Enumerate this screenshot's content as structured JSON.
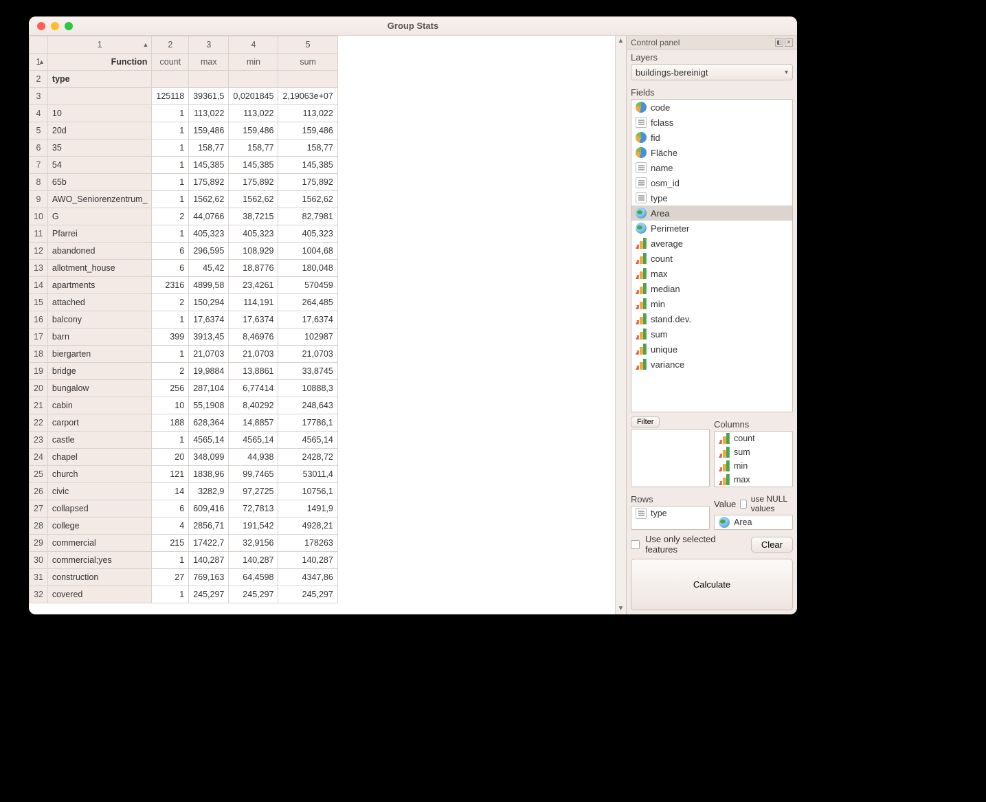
{
  "window_title": "Group Stats",
  "table": {
    "top_headers": [
      "1",
      "2",
      "3",
      "4",
      "5"
    ],
    "function_label": "Function",
    "func_cols": [
      "count",
      "max",
      "min",
      "sum"
    ],
    "type_label": "type",
    "rows": [
      {
        "n": "3",
        "type": "",
        "count": "125118",
        "max": "39361,5",
        "min": "0,0201845",
        "sum": "2,19063e+07"
      },
      {
        "n": "4",
        "type": "10",
        "count": "1",
        "max": "113,022",
        "min": "113,022",
        "sum": "113,022"
      },
      {
        "n": "5",
        "type": "20d",
        "count": "1",
        "max": "159,486",
        "min": "159,486",
        "sum": "159,486"
      },
      {
        "n": "6",
        "type": "35",
        "count": "1",
        "max": "158,77",
        "min": "158,77",
        "sum": "158,77"
      },
      {
        "n": "7",
        "type": "54",
        "count": "1",
        "max": "145,385",
        "min": "145,385",
        "sum": "145,385"
      },
      {
        "n": "8",
        "type": "65b",
        "count": "1",
        "max": "175,892",
        "min": "175,892",
        "sum": "175,892"
      },
      {
        "n": "9",
        "type": "AWO_Seniorenzentrum_",
        "count": "1",
        "max": "1562,62",
        "min": "1562,62",
        "sum": "1562,62"
      },
      {
        "n": "10",
        "type": "G",
        "count": "2",
        "max": "44,0766",
        "min": "38,7215",
        "sum": "82,7981"
      },
      {
        "n": "11",
        "type": "Pfarrei",
        "count": "1",
        "max": "405,323",
        "min": "405,323",
        "sum": "405,323"
      },
      {
        "n": "12",
        "type": "abandoned",
        "count": "6",
        "max": "296,595",
        "min": "108,929",
        "sum": "1004,68"
      },
      {
        "n": "13",
        "type": "allotment_house",
        "count": "6",
        "max": "45,42",
        "min": "18,8776",
        "sum": "180,048"
      },
      {
        "n": "14",
        "type": "apartments",
        "count": "2316",
        "max": "4899,58",
        "min": "23,4261",
        "sum": "570459"
      },
      {
        "n": "15",
        "type": "attached",
        "count": "2",
        "max": "150,294",
        "min": "114,191",
        "sum": "264,485"
      },
      {
        "n": "16",
        "type": "balcony",
        "count": "1",
        "max": "17,6374",
        "min": "17,6374",
        "sum": "17,6374"
      },
      {
        "n": "17",
        "type": "barn",
        "count": "399",
        "max": "3913,45",
        "min": "8,46976",
        "sum": "102987"
      },
      {
        "n": "18",
        "type": "biergarten",
        "count": "1",
        "max": "21,0703",
        "min": "21,0703",
        "sum": "21,0703"
      },
      {
        "n": "19",
        "type": "bridge",
        "count": "2",
        "max": "19,9884",
        "min": "13,8861",
        "sum": "33,8745"
      },
      {
        "n": "20",
        "type": "bungalow",
        "count": "256",
        "max": "287,104",
        "min": "6,77414",
        "sum": "10888,3"
      },
      {
        "n": "21",
        "type": "cabin",
        "count": "10",
        "max": "55,1908",
        "min": "8,40292",
        "sum": "248,643"
      },
      {
        "n": "22",
        "type": "carport",
        "count": "188",
        "max": "628,364",
        "min": "14,8857",
        "sum": "17786,1"
      },
      {
        "n": "23",
        "type": "castle",
        "count": "1",
        "max": "4565,14",
        "min": "4565,14",
        "sum": "4565,14"
      },
      {
        "n": "24",
        "type": "chapel",
        "count": "20",
        "max": "348,099",
        "min": "44,938",
        "sum": "2428,72"
      },
      {
        "n": "25",
        "type": "church",
        "count": "121",
        "max": "1838,96",
        "min": "99,7465",
        "sum": "53011,4"
      },
      {
        "n": "26",
        "type": "civic",
        "count": "14",
        "max": "3282,9",
        "min": "97,2725",
        "sum": "10756,1"
      },
      {
        "n": "27",
        "type": "collapsed",
        "count": "6",
        "max": "609,416",
        "min": "72,7813",
        "sum": "1491,9"
      },
      {
        "n": "28",
        "type": "college",
        "count": "4",
        "max": "2856,71",
        "min": "191,542",
        "sum": "4928,21"
      },
      {
        "n": "29",
        "type": "commercial",
        "count": "215",
        "max": "17422,7",
        "min": "32,9156",
        "sum": "178263"
      },
      {
        "n": "30",
        "type": "commercial;yes",
        "count": "1",
        "max": "140,287",
        "min": "140,287",
        "sum": "140,287"
      },
      {
        "n": "31",
        "type": "construction",
        "count": "27",
        "max": "769,163",
        "min": "64,4598",
        "sum": "4347,86"
      },
      {
        "n": "32",
        "type": "covered",
        "count": "1",
        "max": "245,297",
        "min": "245,297",
        "sum": "245,297"
      }
    ]
  },
  "panel": {
    "title": "Control panel",
    "layers_label": "Layers",
    "layer_selected": "buildings-bereinigt",
    "fields_label": "Fields",
    "fields": [
      {
        "icon": "pie",
        "name": "code"
      },
      {
        "icon": "text",
        "name": "fclass"
      },
      {
        "icon": "pie",
        "name": "fid"
      },
      {
        "icon": "pie",
        "name": "Fläche"
      },
      {
        "icon": "text",
        "name": "name"
      },
      {
        "icon": "text",
        "name": "osm_id"
      },
      {
        "icon": "text",
        "name": "type"
      },
      {
        "icon": "globe",
        "name": "Area",
        "selected": true
      },
      {
        "icon": "globe",
        "name": "Perimeter"
      },
      {
        "icon": "bars",
        "name": "average"
      },
      {
        "icon": "bars",
        "name": "count"
      },
      {
        "icon": "bars",
        "name": "max"
      },
      {
        "icon": "bars",
        "name": "median"
      },
      {
        "icon": "bars",
        "name": "min"
      },
      {
        "icon": "bars",
        "name": "stand.dev."
      },
      {
        "icon": "bars",
        "name": "sum"
      },
      {
        "icon": "bars",
        "name": "unique"
      },
      {
        "icon": "bars",
        "name": "variance"
      }
    ],
    "filter_label": "Filter",
    "columns_label": "Columns",
    "columns_items": [
      {
        "icon": "bars",
        "name": "count"
      },
      {
        "icon": "bars",
        "name": "sum"
      },
      {
        "icon": "bars",
        "name": "min"
      },
      {
        "icon": "bars",
        "name": "max"
      }
    ],
    "rows_label": "Rows",
    "rows_items": [
      {
        "icon": "text",
        "name": "type"
      }
    ],
    "value_label": "Value",
    "use_null_label": "use NULL values",
    "value_items": [
      {
        "icon": "globe",
        "name": "Area"
      }
    ],
    "use_selected_label": "Use only selected features",
    "clear_label": "Clear",
    "calculate_label": "Calculate"
  }
}
